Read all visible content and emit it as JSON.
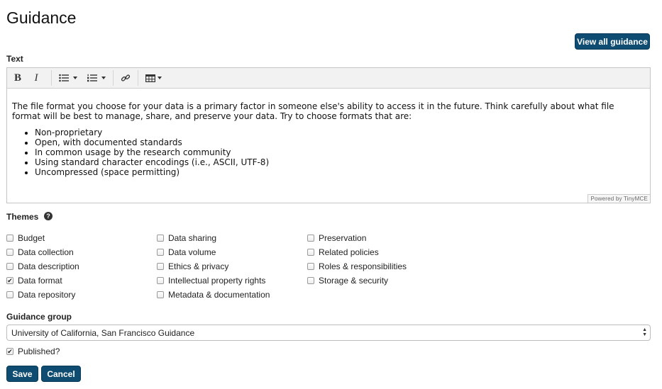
{
  "page": {
    "title": "Guidance"
  },
  "actions": {
    "view_all": "View all guidance",
    "save": "Save",
    "cancel": "Cancel"
  },
  "text_field": {
    "label": "Text",
    "toolbar": {
      "bold": "B",
      "italic": "I"
    },
    "content": {
      "paragraph": "The file format you choose for your data is a primary factor in someone else's ability to access it in the future. Think carefully about what file format will be best to manage, share, and preserve your data. Try to choose formats that are:",
      "bullets": [
        "Non-proprietary",
        "Open, with documented standards",
        "In common usage by the research community",
        "Using standard character encodings (i.e., ASCII, UTF-8)",
        "Uncompressed (space permitting)"
      ]
    },
    "powered_by": "Powered by TinyMCE"
  },
  "themes": {
    "label": "Themes",
    "help_icon": "question-circle-icon",
    "items": [
      {
        "label": "Budget",
        "checked": false
      },
      {
        "label": "Data collection",
        "checked": false
      },
      {
        "label": "Data description",
        "checked": false
      },
      {
        "label": "Data format",
        "checked": true
      },
      {
        "label": "Data repository",
        "checked": false
      },
      {
        "label": "Data sharing",
        "checked": false
      },
      {
        "label": "Data volume",
        "checked": false
      },
      {
        "label": "Ethics & privacy",
        "checked": false
      },
      {
        "label": "Intellectual property rights",
        "checked": false
      },
      {
        "label": "Metadata & documentation",
        "checked": false
      },
      {
        "label": "Preservation",
        "checked": false
      },
      {
        "label": "Related policies",
        "checked": false
      },
      {
        "label": "Roles & responsibilities",
        "checked": false
      },
      {
        "label": "Storage & security",
        "checked": false
      }
    ]
  },
  "guidance_group": {
    "label": "Guidance group",
    "selected": "University of California, San Francisco Guidance"
  },
  "published": {
    "label": "Published?",
    "checked": true
  },
  "colors": {
    "primary": "#0e4c72",
    "toolbar_bg": "#f2f2f2",
    "border": "#c5c5c5"
  }
}
